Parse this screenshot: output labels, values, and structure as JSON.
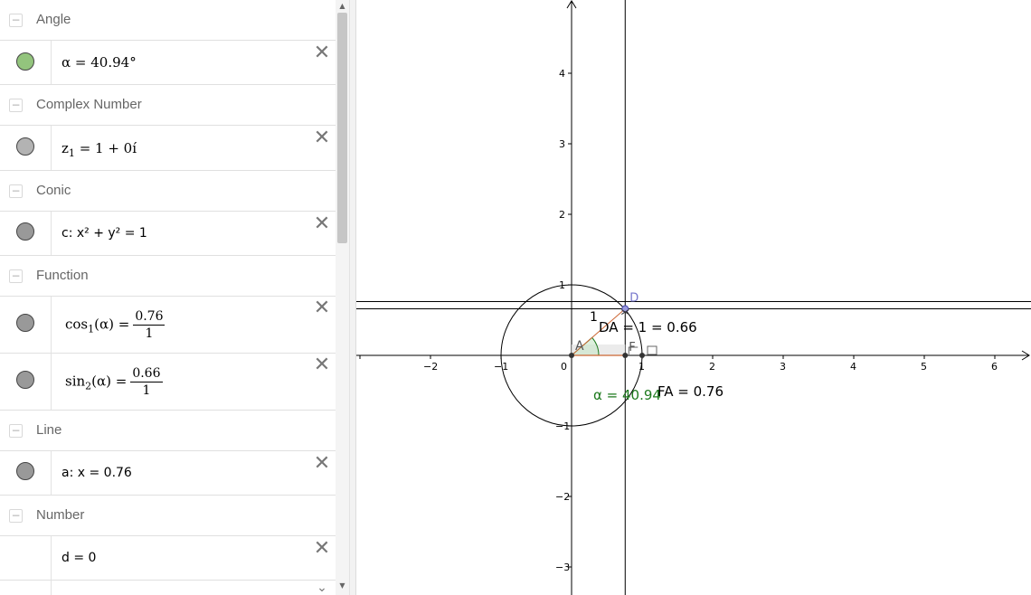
{
  "algebra": {
    "groups": [
      {
        "title": "Angle"
      },
      {
        "title": "Complex Number"
      },
      {
        "title": "Conic"
      },
      {
        "title": "Function"
      },
      {
        "title": "Line"
      },
      {
        "title": "Number"
      }
    ],
    "rows": {
      "alpha": {
        "lhs": "α",
        "rhs": "= 40.94°",
        "color": "#93c47d"
      },
      "z1": {
        "lhs": "z",
        "sub": "1",
        "rhs": "= 1 + 0í",
        "color": "#b3b3b3"
      },
      "c": {
        "text": "c: x² + y² = 1",
        "color": "#999999"
      },
      "cos": {
        "fn": "cos",
        "sub": "1",
        "arg": "(α) =",
        "num": "0.76",
        "den": "1",
        "color": "#999999"
      },
      "sin": {
        "fn": "sin",
        "sub": "2",
        "arg": "(α) =",
        "num": "0.66",
        "den": "1",
        "color": "#999999"
      },
      "a": {
        "text": "a: x = 0.76",
        "color": "#999999"
      },
      "d": {
        "text": "d = 0"
      }
    },
    "delete_glyph": "✕",
    "collapse_glyph": "−"
  },
  "graph": {
    "x_ticks": [
      "−2",
      "−1",
      "0",
      "1",
      "2",
      "3",
      "4",
      "5",
      "6"
    ],
    "y_ticks": [
      "4",
      "3",
      "2",
      "1",
      "−1",
      "−2",
      "−3"
    ],
    "x_range": [
      -3,
      6.5
    ],
    "y_range": [
      -3.4,
      5
    ],
    "labels": {
      "point_d": "D",
      "point_a": "A",
      "point_f": "F",
      "one": "1",
      "da": "DA = 1 = 0.66",
      "fa": "FA = 0.76",
      "alpha": "α = 40.94"
    },
    "colors": {
      "alpha": "#1e7a1e",
      "point_d": "#7777cc",
      "segment": "#cc6633"
    },
    "cos_value": 0.76,
    "sin_value": 0.66
  }
}
